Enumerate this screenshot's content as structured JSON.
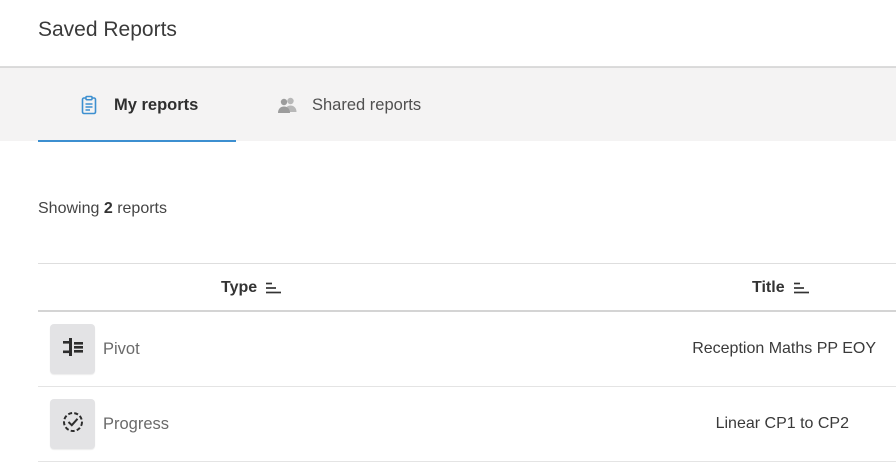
{
  "page": {
    "title": "Saved Reports"
  },
  "tabs": [
    {
      "label": "My reports",
      "icon": "clipboard-icon",
      "active": true
    },
    {
      "label": "Shared reports",
      "icon": "people-icon",
      "active": false
    }
  ],
  "summary": {
    "prefix": "Showing",
    "count": "2",
    "suffix": "reports"
  },
  "table": {
    "columns": [
      {
        "label": "Type",
        "sort_icon": "sort-icon"
      },
      {
        "label": "Title",
        "sort_icon": "sort-icon"
      }
    ],
    "rows": [
      {
        "type": "Pivot",
        "type_icon": "pivot-icon",
        "title": "Reception Maths PP EOY"
      },
      {
        "type": "Progress",
        "type_icon": "progress-icon",
        "title": "Linear CP1 to CP2"
      }
    ]
  },
  "colors": {
    "accent": "#3c8fd0",
    "tab_bar": "#f4f3f3",
    "badge": "#e3e3e5"
  }
}
